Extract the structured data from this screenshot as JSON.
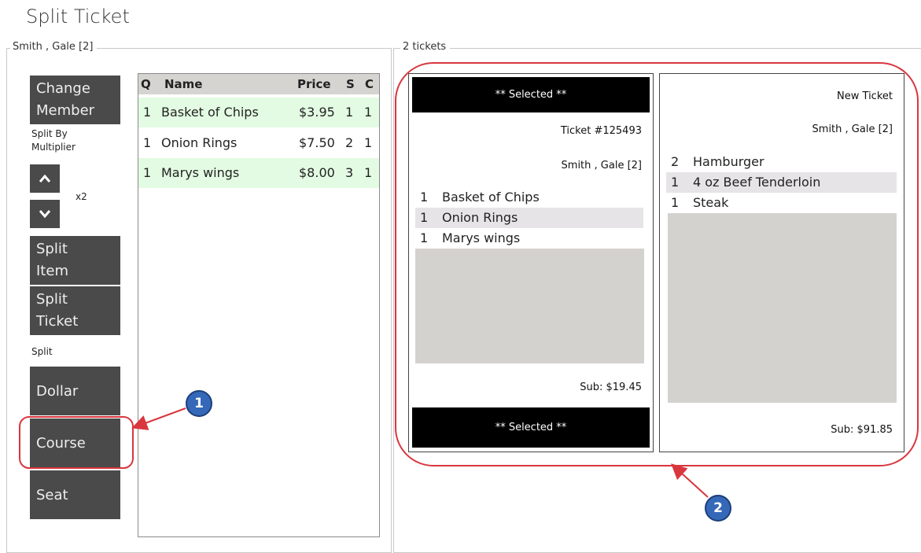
{
  "page_title": "Split Ticket",
  "member_group": {
    "legend": "Smith , Gale [2]",
    "buttons": {
      "change_member_line1": "Change",
      "change_member_line2": "Member",
      "split_by_line1": "Split By",
      "split_by_line2": "Multiplier",
      "multiplier_value": "x2",
      "split_item_line1": "Split",
      "split_item_line2": "Item",
      "split_ticket_line1": "Split",
      "split_ticket_line2": "Ticket",
      "split_label": "Split",
      "dollar": "Dollar",
      "course": "Course",
      "seat": "Seat"
    },
    "list": {
      "columns": [
        "Q",
        "Name",
        "Price",
        "S",
        "C"
      ],
      "rows": [
        {
          "q": "1",
          "name": "Basket of Chips",
          "price": "$3.95",
          "s": "1",
          "c": "1",
          "highlight": true
        },
        {
          "q": "1",
          "name": "Onion Rings",
          "price": "$7.50",
          "s": "2",
          "c": "1",
          "highlight": false
        },
        {
          "q": "1",
          "name": "Marys wings",
          "price": "$8.00",
          "s": "3",
          "c": "1",
          "highlight": true
        }
      ]
    }
  },
  "tickets_group": {
    "legend": "2 tickets",
    "ticket1": {
      "top_bar": "** Selected **",
      "ticket_number": "Ticket #125493",
      "member": "Smith , Gale [2]",
      "items": [
        {
          "q": "1",
          "name": "Basket of Chips"
        },
        {
          "q": "1",
          "name": "Onion Rings"
        },
        {
          "q": "1",
          "name": "Marys wings"
        }
      ],
      "subtotal": "Sub: $19.45",
      "bottom_bar": "** Selected **"
    },
    "ticket2": {
      "title": "New Ticket",
      "member": "Smith , Gale [2]",
      "items": [
        {
          "q": "2",
          "name": "Hamburger"
        },
        {
          "q": "1",
          "name": "4 oz Beef Tenderloin"
        },
        {
          "q": "1",
          "name": "Steak"
        }
      ],
      "subtotal": "Sub: $91.85"
    }
  },
  "callouts": {
    "one": "1",
    "two": "2"
  },
  "colors": {
    "button_bg": "#4a4a4a",
    "highlight_green": "#e3fbe3",
    "annotation_red": "#d9363e",
    "callout_blue": "#3568b8"
  },
  "icons": {
    "up": "chevron-up-icon",
    "down": "chevron-down-icon"
  }
}
